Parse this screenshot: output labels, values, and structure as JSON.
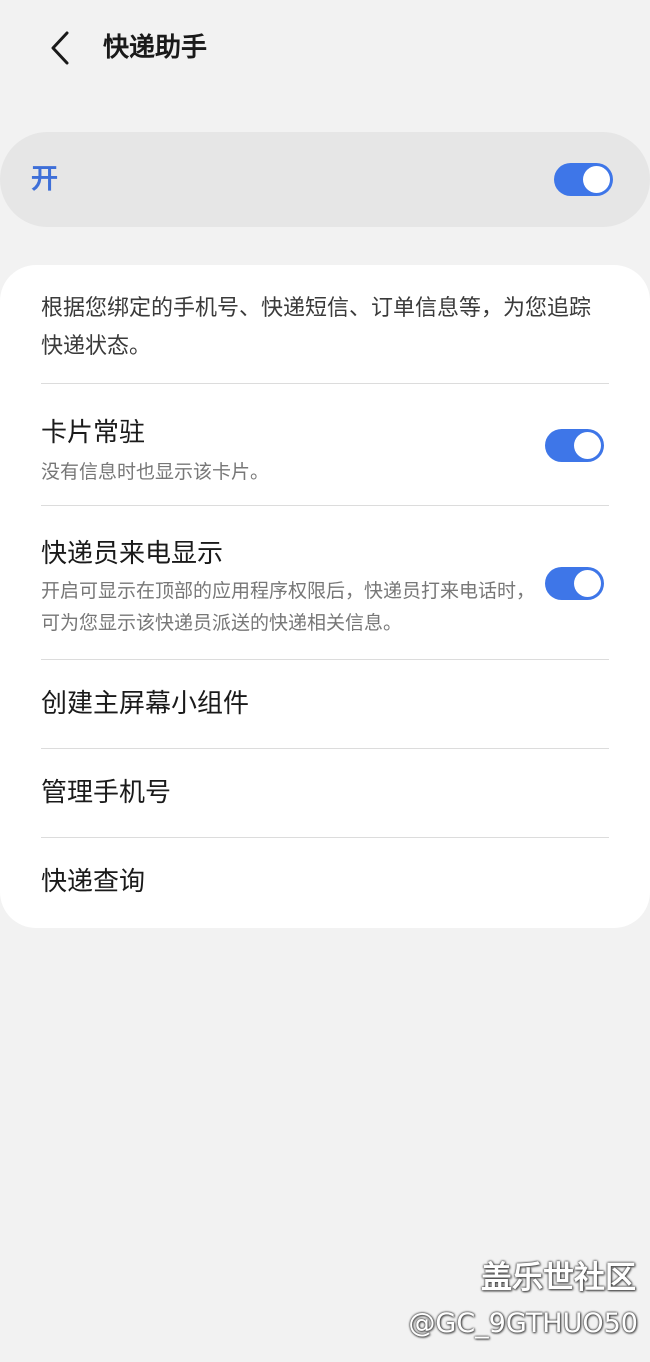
{
  "header": {
    "title": "快递助手"
  },
  "master": {
    "label": "开",
    "enabled": true,
    "accent": "#3e76e8"
  },
  "settings": {
    "description": "根据您绑定的手机号、快递短信、订单信息等，为您追踪快递状态。",
    "card_pinned": {
      "title": "卡片常驻",
      "subtitle": "没有信息时也显示该卡片。",
      "enabled": true
    },
    "courier_call": {
      "title": "快递员来电显示",
      "subtitle": "开启可显示在顶部的应用程序权限后，快递员打来电话时，可为您显示该快递员派送的快递相关信息。",
      "enabled": true
    },
    "menu": [
      {
        "label": "创建主屏幕小组件"
      },
      {
        "label": "管理手机号"
      },
      {
        "label": "快递查询"
      }
    ]
  },
  "watermark": {
    "brand": "盖乐世社区",
    "user": "@GC_9GTHUO50"
  },
  "icons": {
    "back": "chevron-left-icon"
  }
}
